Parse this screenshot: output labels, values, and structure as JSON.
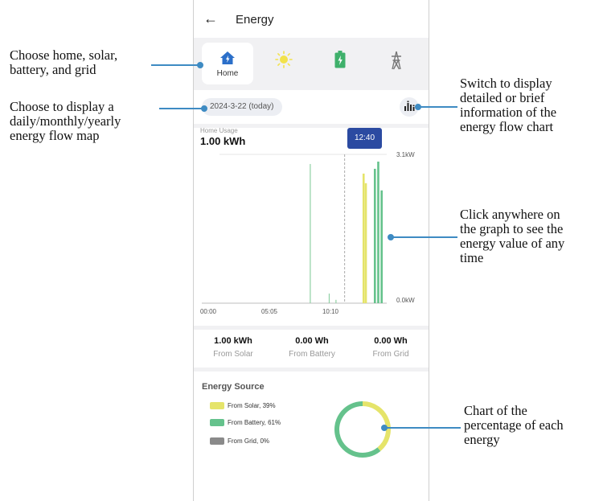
{
  "header": {
    "back_icon": "arrow-left-icon",
    "title": "Energy"
  },
  "tabs": [
    {
      "key": "home",
      "label": "Home",
      "icon": "home-icon",
      "active": true
    },
    {
      "key": "solar",
      "label": "",
      "icon": "sun-icon",
      "active": false
    },
    {
      "key": "battery",
      "label": "",
      "icon": "battery-icon",
      "active": false
    },
    {
      "key": "grid",
      "label": "",
      "icon": "transmission-tower-icon",
      "active": false
    }
  ],
  "date_selector": {
    "value": "2024-3-22 (today)"
  },
  "display_mode_button": {
    "icon": "bar-chart-icon"
  },
  "usage": {
    "label": "Home Usage",
    "value": "1.00 kWh",
    "tooltip_time": "12:40"
  },
  "chart_data": {
    "type": "bar",
    "x_ticks": [
      "00:00",
      "05:05",
      "10:10"
    ],
    "y_ticks": [
      "3.1kW",
      "0.0kW"
    ],
    "ylim": [
      0,
      3.1
    ],
    "x_range_hours": [
      0,
      16.4
    ],
    "cursor_time": "12:40",
    "series": [
      {
        "color": "#8fd0a4",
        "points": [
          [
            9.62,
            2.9
          ],
          [
            11.3,
            0.2
          ],
          [
            11.9,
            0.07
          ]
        ]
      },
      {
        "color": "#e5e46a",
        "points": [
          [
            14.35,
            2.7
          ],
          [
            14.55,
            2.5
          ]
        ]
      },
      {
        "color": "#65c28c",
        "points": [
          [
            15.35,
            2.8
          ],
          [
            15.65,
            2.95
          ],
          [
            15.95,
            2.35
          ]
        ]
      }
    ]
  },
  "stats": [
    {
      "value": "1.00 kWh",
      "label": "From Solar"
    },
    {
      "value": "0.00 Wh",
      "label": "From Battery"
    },
    {
      "value": "0.00 Wh",
      "label": "From Grid"
    }
  ],
  "energy_source": {
    "title": "Energy Source",
    "items": [
      {
        "label": "From Solar, 39%",
        "color": "#e5e46a",
        "pct": 39
      },
      {
        "label": "From Battery, 61%",
        "color": "#65c28c",
        "pct": 61
      },
      {
        "label": "From Grid, 0%",
        "color": "#8a8a8a",
        "pct": 0
      }
    ]
  },
  "annotations": {
    "tabs": [
      "Choose home, solar,",
      "battery, and grid"
    ],
    "date": [
      "Choose to display a",
      "daily/monthly/yearly",
      "energy flow map"
    ],
    "mode": [
      "Switch to display",
      "detailed or brief",
      "information of the",
      "energy flow chart"
    ],
    "chart": [
      "Click anywhere on",
      "the graph to see the",
      "energy value of any",
      "time"
    ],
    "donut": [
      "Chart of the",
      "percentage of each",
      "energy"
    ]
  },
  "colors": {
    "annotation_line": "#3e8bc3",
    "accent": "#2b4aa1"
  }
}
